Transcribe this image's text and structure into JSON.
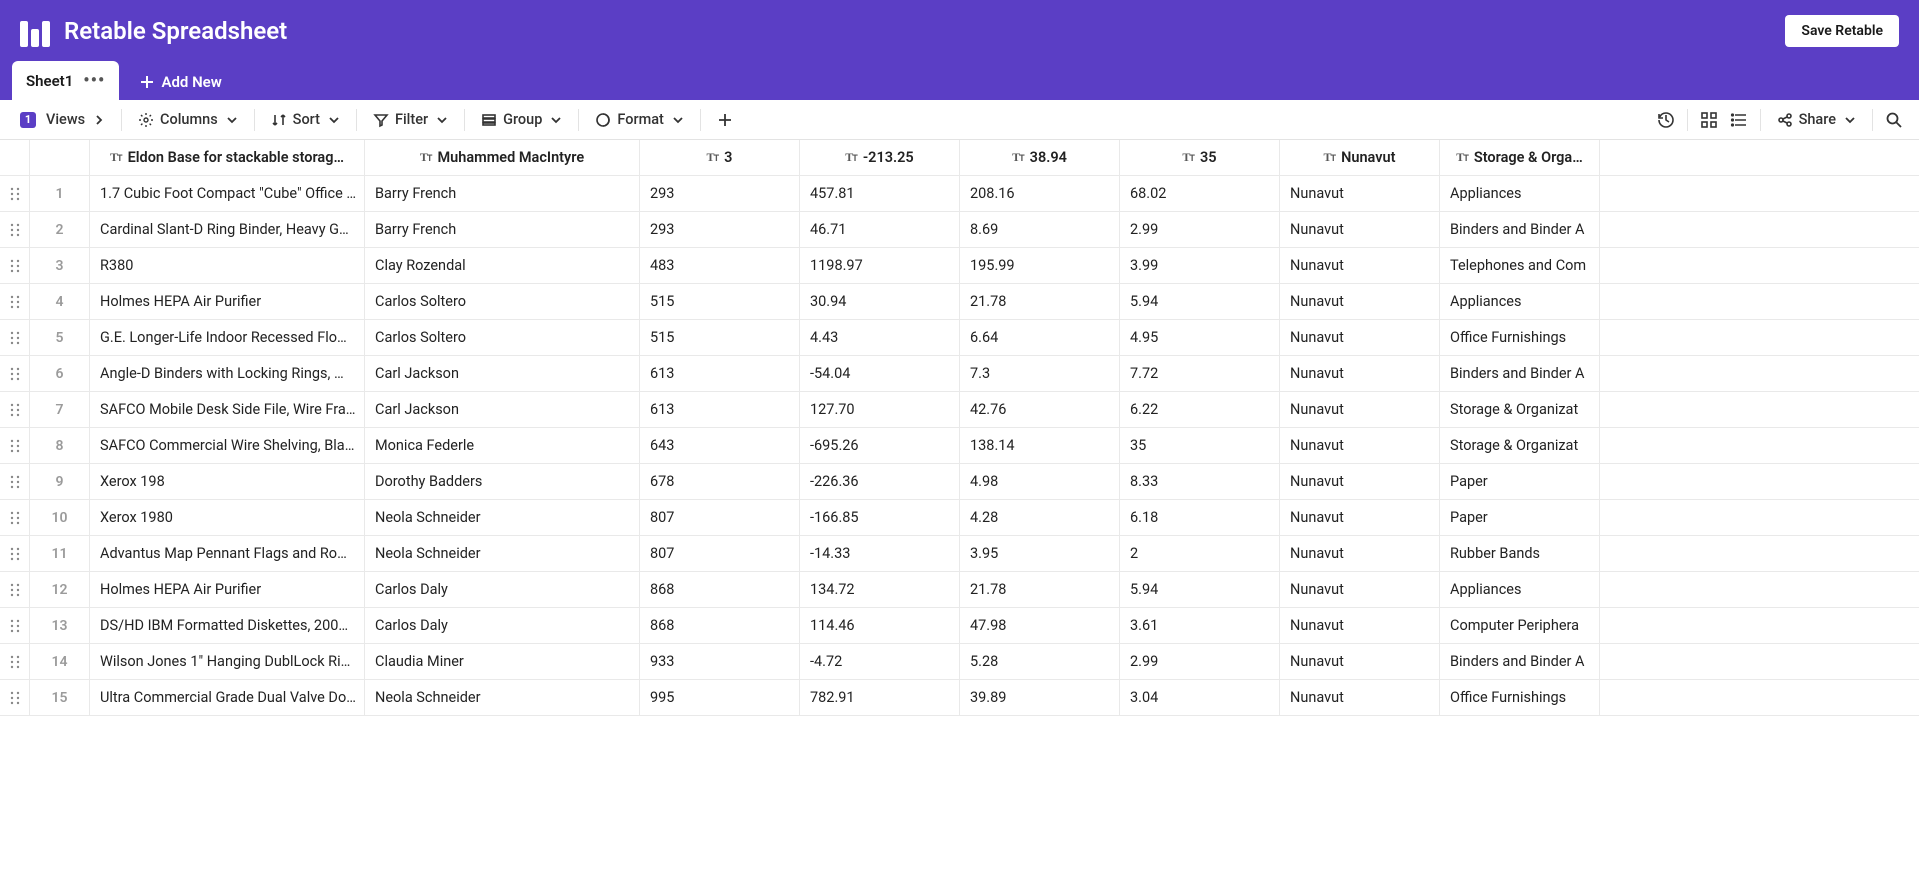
{
  "header": {
    "title": "Retable Spreadsheet",
    "save_label": "Save Retable"
  },
  "tabs": {
    "sheet_label": "Sheet1",
    "add_new_label": "Add New"
  },
  "toolbar": {
    "views_count": "1",
    "views_label": "Views",
    "columns_label": "Columns",
    "sort_label": "Sort",
    "filter_label": "Filter",
    "group_label": "Group",
    "format_label": "Format",
    "share_label": "Share"
  },
  "columns": [
    "Eldon Base for stackable storag…",
    "Muhammed MacIntyre",
    "3",
    "-213.25",
    "38.94",
    "35",
    "Nunavut",
    "Storage & Orga…"
  ],
  "rows": [
    [
      "1.7 Cubic Foot Compact \"Cube\" Office …",
      "Barry French",
      "293",
      "457.81",
      "208.16",
      "68.02",
      "Nunavut",
      "Appliances"
    ],
    [
      "Cardinal Slant-D Ring Binder, Heavy G…",
      "Barry French",
      "293",
      "46.71",
      "8.69",
      "2.99",
      "Nunavut",
      "Binders and Binder A"
    ],
    [
      "R380",
      "Clay Rozendal",
      "483",
      "1198.97",
      "195.99",
      "3.99",
      "Nunavut",
      "Telephones and Com"
    ],
    [
      "Holmes HEPA Air Purifier",
      "Carlos Soltero",
      "515",
      "30.94",
      "21.78",
      "5.94",
      "Nunavut",
      "Appliances"
    ],
    [
      "G.E. Longer-Life Indoor Recessed Flo…",
      "Carlos Soltero",
      "515",
      "4.43",
      "6.64",
      "4.95",
      "Nunavut",
      "Office Furnishings"
    ],
    [
      "Angle-D Binders with Locking Rings, …",
      "Carl Jackson",
      "613",
      "-54.04",
      "7.3",
      "7.72",
      "Nunavut",
      "Binders and Binder A"
    ],
    [
      "SAFCO Mobile Desk Side File, Wire Fra…",
      "Carl Jackson",
      "613",
      "127.70",
      "42.76",
      "6.22",
      "Nunavut",
      "Storage & Organizat"
    ],
    [
      "SAFCO Commercial Wire Shelving, Bla…",
      "Monica Federle",
      "643",
      "-695.26",
      "138.14",
      "35",
      "Nunavut",
      "Storage & Organizat"
    ],
    [
      "Xerox 198",
      "Dorothy Badders",
      "678",
      "-226.36",
      "4.98",
      "8.33",
      "Nunavut",
      "Paper"
    ],
    [
      "Xerox 1980",
      "Neola Schneider",
      "807",
      "-166.85",
      "4.28",
      "6.18",
      "Nunavut",
      "Paper"
    ],
    [
      "Advantus Map Pennant Flags and Ro…",
      "Neola Schneider",
      "807",
      "-14.33",
      "3.95",
      "2",
      "Nunavut",
      "Rubber Bands"
    ],
    [
      "Holmes HEPA Air Purifier",
      "Carlos Daly",
      "868",
      "134.72",
      "21.78",
      "5.94",
      "Nunavut",
      "Appliances"
    ],
    [
      "DS/HD IBM Formatted Diskettes, 200…",
      "Carlos Daly",
      "868",
      "114.46",
      "47.98",
      "3.61",
      "Nunavut",
      "Computer Periphera"
    ],
    [
      "Wilson Jones 1\" Hanging DublLock Ri…",
      "Claudia Miner",
      "933",
      "-4.72",
      "5.28",
      "2.99",
      "Nunavut",
      "Binders and Binder A"
    ],
    [
      "Ultra Commercial Grade Dual Valve Do…",
      "Neola Schneider",
      "995",
      "782.91",
      "39.89",
      "3.04",
      "Nunavut",
      "Office Furnishings"
    ]
  ]
}
